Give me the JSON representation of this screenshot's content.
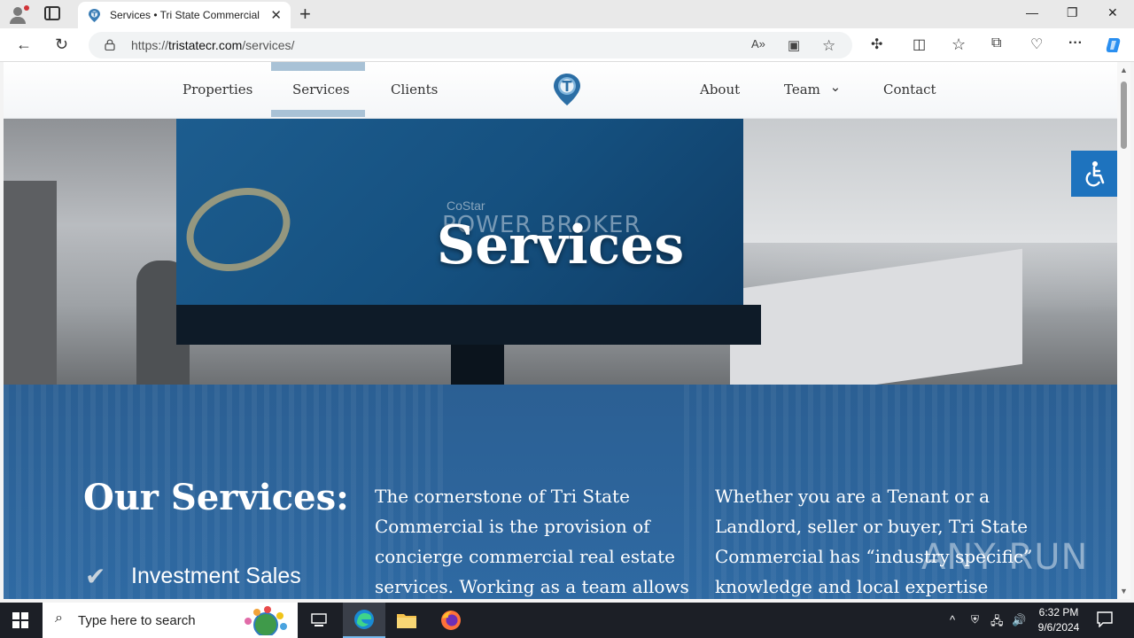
{
  "browser": {
    "tab": {
      "title": "Services • Tri State Commercial",
      "close_glyph": "✕"
    },
    "new_tab_glyph": "+",
    "window": {
      "minimize": "—",
      "restore": "❐",
      "close": "✕"
    },
    "url_scheme": "https://",
    "url_host": "tristatecr.com",
    "url_path": "/services/",
    "nav": {
      "back": "←",
      "refresh": "↻"
    },
    "address_icons": {
      "read_aloud": "A»",
      "immersive": "▣",
      "favorite": "☆"
    },
    "toolbar_icons": {
      "extensions": "✣",
      "split": "◫",
      "favorites": "☆",
      "collections": "⧉",
      "performance": "♡",
      "more": "···"
    }
  },
  "site": {
    "nav_left": [
      "Properties",
      "Services",
      "Clients"
    ],
    "nav_right": [
      "About",
      "Team",
      "Contact"
    ],
    "team_chevron": "⌄",
    "hero_title": "Services",
    "billboard": {
      "brand": "CoStar",
      "headline": "POWER BROKER"
    },
    "section": {
      "heading": "Our Services:",
      "check_glyph": "✔",
      "items": [
        "Investment Sales"
      ],
      "col2_lines": [
        "The cornerstone of Tri State",
        "Commercial is the provision of",
        "concierge commercial real estate",
        "services. Working as a team allows"
      ],
      "col3_lines": [
        "Whether you are a Tenant or a",
        "Landlord, seller or buyer, Tri State",
        "Commercial has “industry specific”",
        "knowledge and local expertise"
      ]
    },
    "watermark": "ANY RUN"
  },
  "colors": {
    "brand_blue": "#2f6aa3",
    "nav_active": "#a9c2d6",
    "access_blue": "#1e73be"
  },
  "taskbar": {
    "search_placeholder": "Type here to search",
    "search_glyph": "⌕",
    "tray": {
      "chevron": "^",
      "network": "🖧",
      "volume": "🔊"
    },
    "time": "6:32 PM",
    "date": "9/6/2024"
  }
}
